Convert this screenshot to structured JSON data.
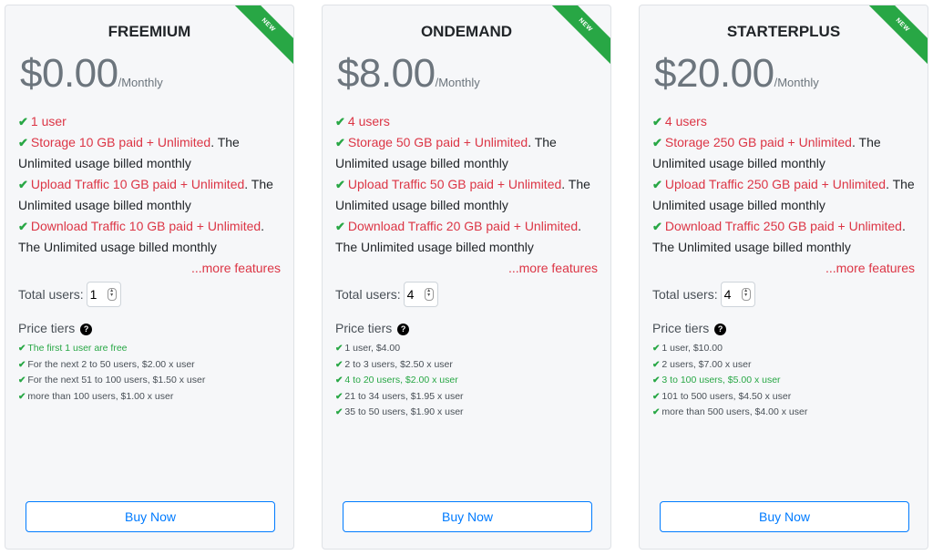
{
  "plans": [
    {
      "ribbon": "NEW",
      "name": "FREEMIUM",
      "price": "$0.00",
      "period": "/Monthly",
      "features": [
        {
          "hi": "1 user",
          "rest": ""
        },
        {
          "hi": "Storage 10 GB paid + Unlimited",
          "rest": ". The Unlimited usage billed monthly"
        },
        {
          "hi": "Upload Traffic 10 GB paid + Unlimited",
          "rest": ". The Unlimited usage billed monthly"
        },
        {
          "hi": "Download Traffic 10 GB paid + Unlimited",
          "rest": ". The Unlimited usage billed monthly"
        }
      ],
      "more": "...more features",
      "users_label": "Total users:",
      "users_value": "1",
      "tiers_label": "Price tiers",
      "tiers": [
        {
          "text": "The first 1 user are free",
          "active": true
        },
        {
          "text": "For the next 2 to 50 users, $2.00 x user",
          "active": false
        },
        {
          "text": "For the next 51 to 100 users, $1.50 x user",
          "active": false
        },
        {
          "text": "more than 100 users, $1.00 x user",
          "active": false
        }
      ],
      "buy": "Buy Now"
    },
    {
      "ribbon": "NEW",
      "name": "ONDEMAND",
      "price": "$8.00",
      "period": "/Monthly",
      "features": [
        {
          "hi": "4 users",
          "rest": ""
        },
        {
          "hi": "Storage 50 GB paid + Unlimited",
          "rest": ". The Unlimited usage billed monthly"
        },
        {
          "hi": "Upload Traffic 50 GB paid + Unlimited",
          "rest": ". The Unlimited usage billed monthly"
        },
        {
          "hi": "Download Traffic 20 GB paid + Unlimited",
          "rest": ". The Unlimited usage billed monthly"
        }
      ],
      "more": "...more features",
      "users_label": "Total users:",
      "users_value": "4",
      "tiers_label": "Price tiers",
      "tiers": [
        {
          "text": "1 user, $4.00",
          "active": false
        },
        {
          "text": "2 to 3 users, $2.50 x user",
          "active": false
        },
        {
          "text": "4 to 20 users, $2.00 x user",
          "active": true
        },
        {
          "text": "21 to 34 users, $1.95 x user",
          "active": false
        },
        {
          "text": "35 to 50 users, $1.90 x user",
          "active": false
        }
      ],
      "buy": "Buy Now"
    },
    {
      "ribbon": "NEW",
      "name": "STARTERPLUS",
      "price": "$20.00",
      "period": "/Monthly",
      "features": [
        {
          "hi": "4 users",
          "rest": ""
        },
        {
          "hi": "Storage 250 GB paid + Unlimited",
          "rest": ". The Unlimited usage billed monthly"
        },
        {
          "hi": "Upload Traffic 250 GB paid + Unlimited",
          "rest": ". The Unlimited usage billed monthly"
        },
        {
          "hi": "Download Traffic 250 GB paid + Unlimited",
          "rest": ". The Unlimited usage billed monthly"
        }
      ],
      "more": "...more features",
      "users_label": "Total users:",
      "users_value": "4",
      "tiers_label": "Price tiers",
      "tiers": [
        {
          "text": "1 user, $10.00",
          "active": false
        },
        {
          "text": "2 users, $7.00 x user",
          "active": false
        },
        {
          "text": "3 to 100 users, $5.00 x user",
          "active": true
        },
        {
          "text": "101 to 500 users, $4.50 x user",
          "active": false
        },
        {
          "text": "more than 500 users, $4.00 x user",
          "active": false
        }
      ],
      "buy": "Buy Now"
    }
  ],
  "colors": {
    "accent_green": "#28a745",
    "highlight_red": "#dc3545",
    "button_blue": "#007bff"
  }
}
